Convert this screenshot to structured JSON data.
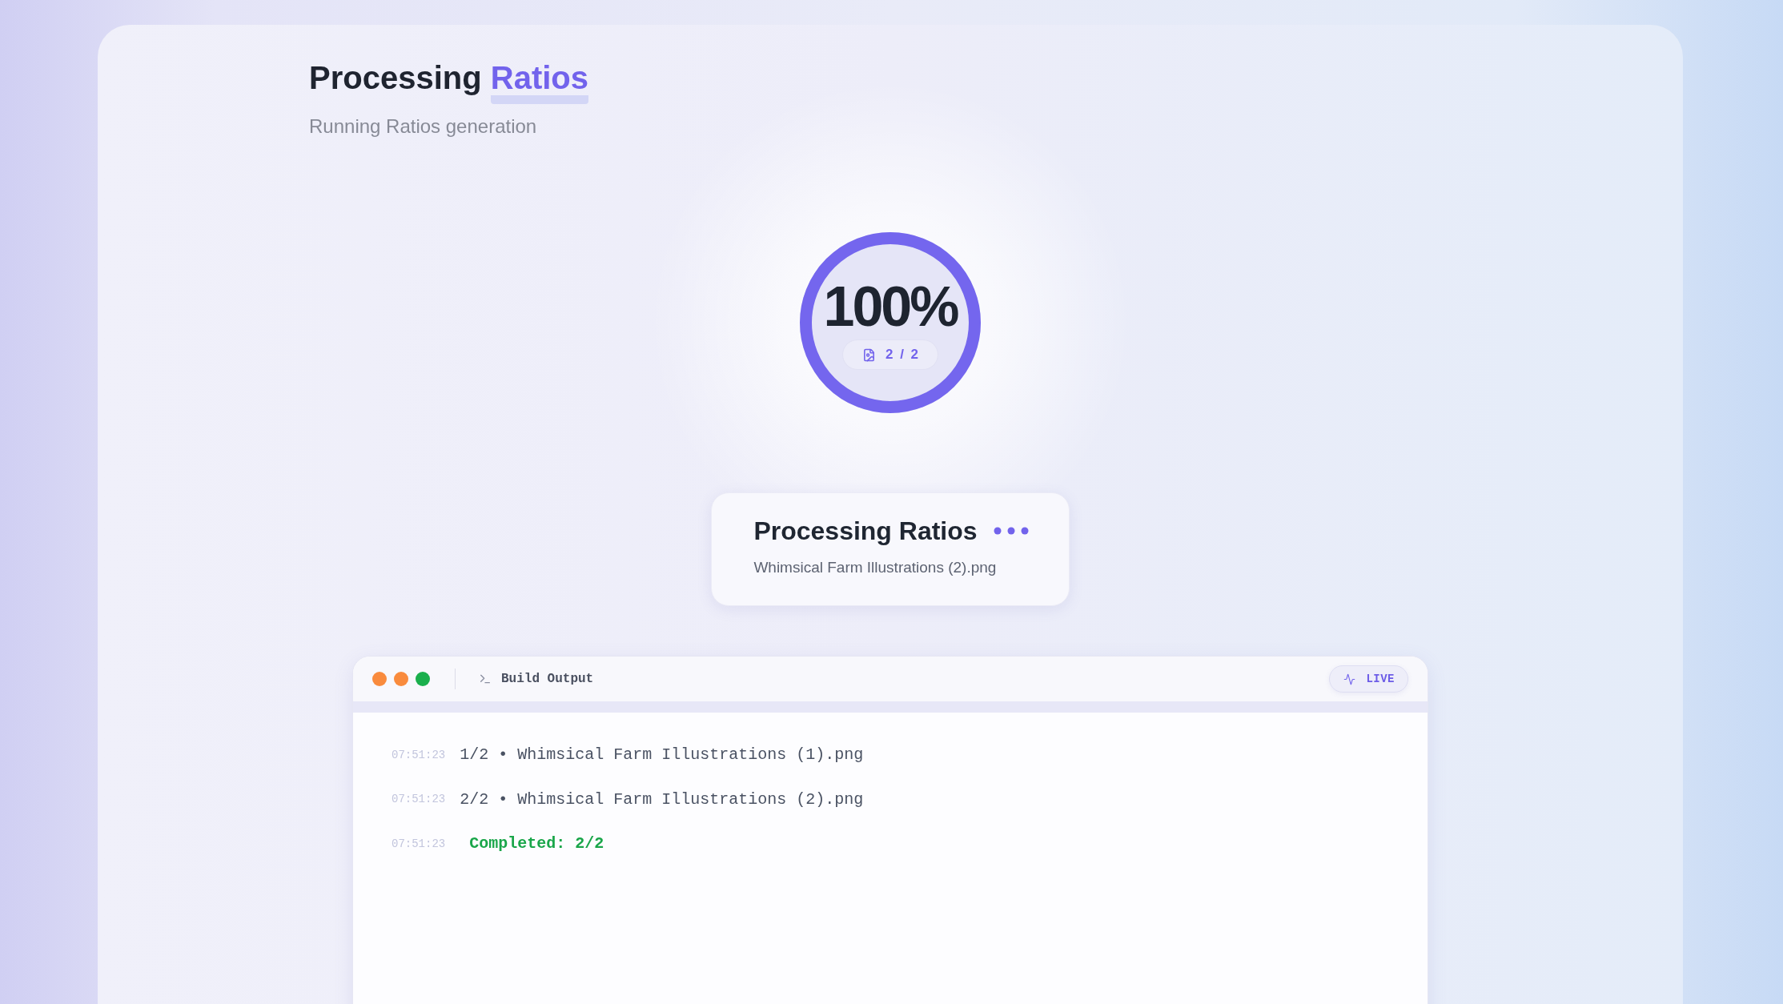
{
  "header": {
    "title": "Processing",
    "title_accent": "Ratios",
    "subtitle": "Running Ratios generation"
  },
  "progress": {
    "percent": "100%",
    "level": 1,
    "count": "2 / 2"
  },
  "status_card": {
    "title": "Processing Ratios",
    "file": "Whimsical Farm Illustrations (2).png"
  },
  "terminal": {
    "window_dots": [
      {
        "color": "#f98b3d"
      },
      {
        "color": "#f98b3d"
      },
      {
        "color": "#1aaf4c"
      }
    ],
    "title": "Build Output",
    "badge": "LIVE",
    "lines": [
      {
        "time": "07:51:23",
        "kind": "progress",
        "text": "1/2 • Whimsical Farm Illustrations (1).png"
      },
      {
        "time": "07:51:23",
        "kind": "progress",
        "text": "2/2 • Whimsical Farm Illustrations (2).png"
      },
      {
        "time": "07:51:23",
        "kind": "success",
        "text": "Completed: 2/2"
      }
    ]
  }
}
